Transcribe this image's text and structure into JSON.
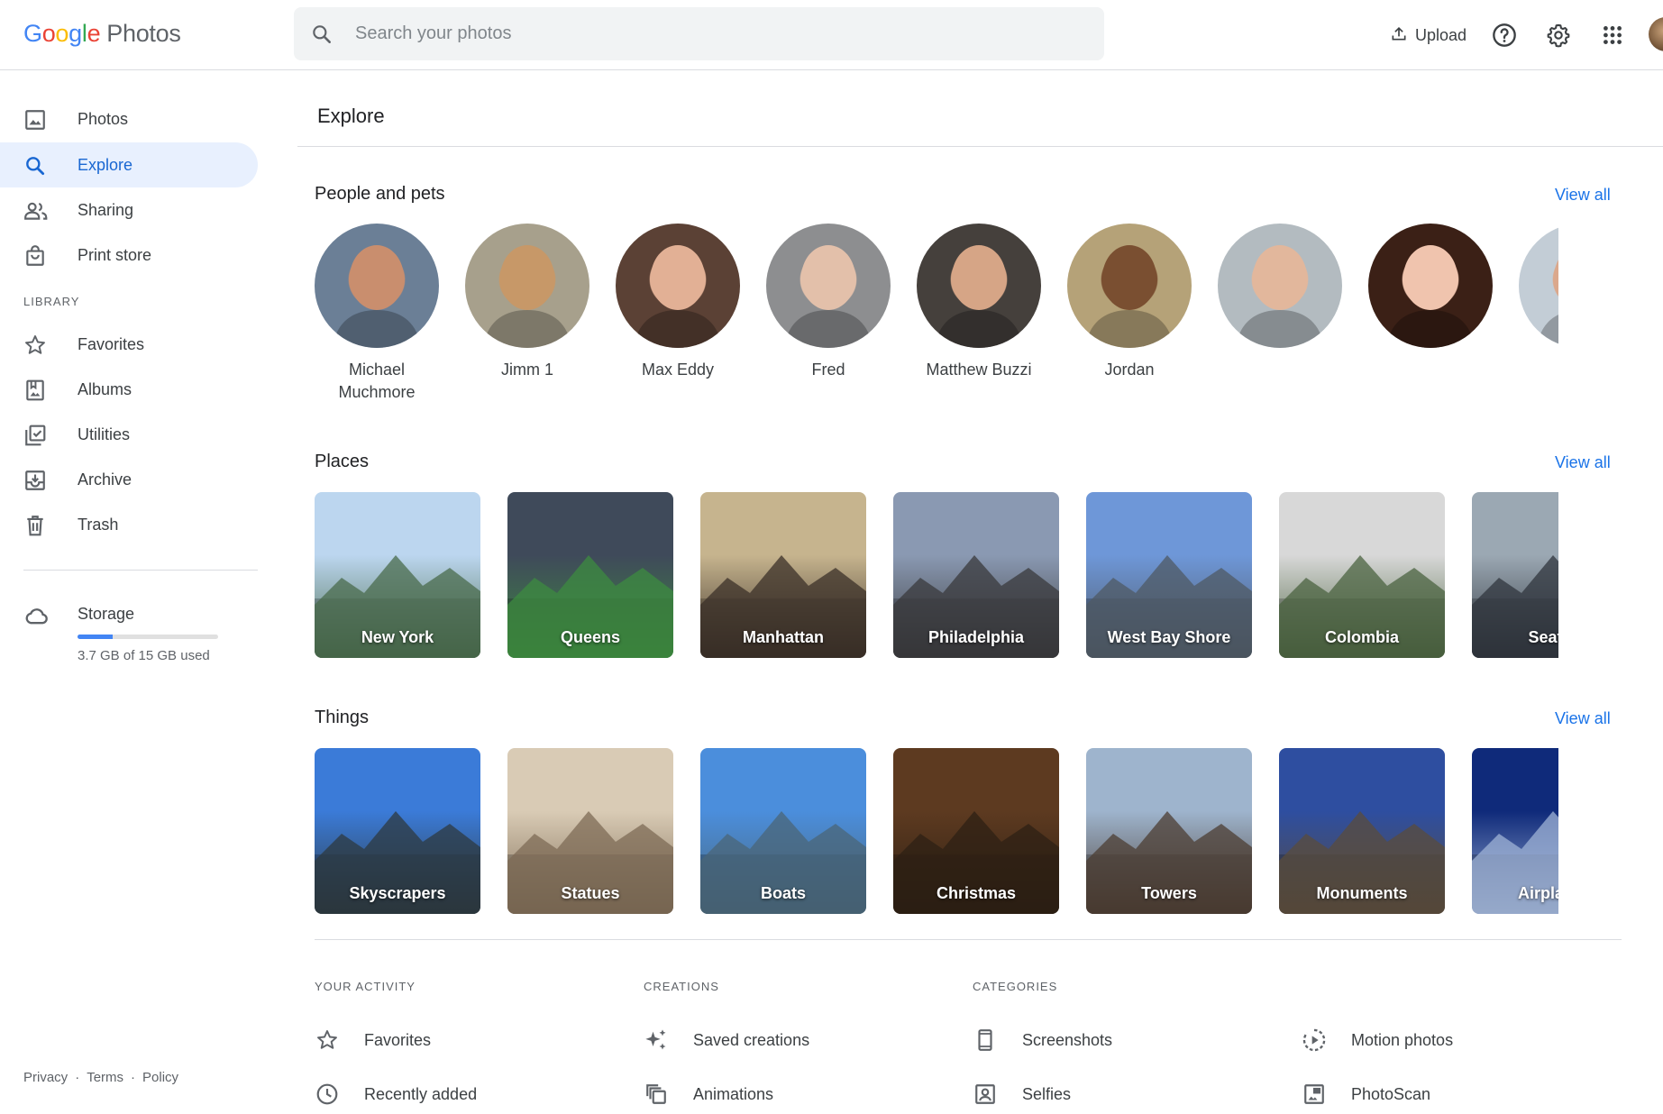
{
  "header": {
    "logo": {
      "letters": [
        "G",
        "o",
        "o",
        "g",
        "l",
        "e"
      ],
      "product": "Photos"
    },
    "search_placeholder": "Search your photos",
    "upload_label": "Upload",
    "icons": [
      "search-icon",
      "upload-icon",
      "help-icon",
      "settings-icon",
      "apps-grid-icon"
    ]
  },
  "sidebar": {
    "items": [
      {
        "label": "Photos",
        "icon": "photo-icon",
        "active": false
      },
      {
        "label": "Explore",
        "icon": "search-icon",
        "active": true
      },
      {
        "label": "Sharing",
        "icon": "people-icon",
        "active": false
      },
      {
        "label": "Print store",
        "icon": "shopping-bag-icon",
        "active": false
      }
    ],
    "library_heading": "LIBRARY",
    "library_items": [
      {
        "label": "Favorites",
        "icon": "star-icon"
      },
      {
        "label": "Albums",
        "icon": "album-icon"
      },
      {
        "label": "Utilities",
        "icon": "utilities-icon"
      },
      {
        "label": "Archive",
        "icon": "archive-icon"
      },
      {
        "label": "Trash",
        "icon": "trash-icon"
      }
    ],
    "storage": {
      "label": "Storage",
      "usage_text": "3.7 GB of 15 GB used",
      "used_fraction": 0.247
    },
    "footer": {
      "privacy": "Privacy",
      "terms": "Terms",
      "policy": "Policy",
      "sep": "·"
    }
  },
  "main": {
    "title": "Explore",
    "view_all": "View all",
    "people": {
      "title": "People and pets",
      "items": [
        {
          "name": "Michael Muchmore",
          "skin": "#c98e6e",
          "bg": "#6b7f96"
        },
        {
          "name": "Jimm   1",
          "skin": "#c79868",
          "bg": "#a7a08c"
        },
        {
          "name": "Max Eddy",
          "skin": "#e2b095",
          "bg": "#5b4135"
        },
        {
          "name": "Fred",
          "skin": "#e3c0aa",
          "bg": "#8d8e90"
        },
        {
          "name": "Matthew Buzzi",
          "skin": "#d6a586",
          "bg": "#45403c"
        },
        {
          "name": "Jordan",
          "skin": "#7a4f31",
          "bg": "#b5a278"
        },
        {
          "name": "",
          "skin": "#e2b79c",
          "bg": "#b3bbc0"
        },
        {
          "name": "",
          "skin": "#f0c4ae",
          "bg": "#3b2016"
        },
        {
          "name": "",
          "skin": "#dba88c",
          "bg": "#c3cdd6"
        }
      ]
    },
    "places": {
      "title": "Places",
      "items": [
        {
          "label": "New York",
          "top": "#bcd6ef",
          "bottom": "#496b4c"
        },
        {
          "label": "Queens",
          "top": "#3f4a5a",
          "bottom": "#3e8b40"
        },
        {
          "label": "Manhattan",
          "top": "#c6b48e",
          "bottom": "#3b3028"
        },
        {
          "label": "Philadelphia",
          "top": "#8a99b2",
          "bottom": "#3a3a3c"
        },
        {
          "label": "West Bay Shore",
          "top": "#6e97d8",
          "bottom": "#4f5964"
        },
        {
          "label": "Colombia",
          "top": "#d8d8d8",
          "bottom": "#4b6340"
        },
        {
          "label": "Seattle",
          "top": "#9ba8b3",
          "bottom": "#30363d"
        }
      ]
    },
    "things": {
      "title": "Things",
      "items": [
        {
          "label": "Skyscrapers",
          "top": "#3b7bd8",
          "bottom": "#2e3a40"
        },
        {
          "label": "Statues",
          "top": "#d9cbb5",
          "bottom": "#7d6b55"
        },
        {
          "label": "Boats",
          "top": "#4b8edc",
          "bottom": "#4a6678"
        },
        {
          "label": "Christmas",
          "top": "#5d3a20",
          "bottom": "#2e2014"
        },
        {
          "label": "Towers",
          "top": "#9eb4cd",
          "bottom": "#4c3d33"
        },
        {
          "label": "Monuments",
          "top": "#2e4ea0",
          "bottom": "#5a4c3c"
        },
        {
          "label": "Airplanes",
          "top": "#0f2a7a",
          "bottom": "#9fb3d6"
        }
      ]
    },
    "activity": {
      "heading": "YOUR ACTIVITY",
      "items": [
        {
          "label": "Favorites",
          "icon": "star-icon"
        },
        {
          "label": "Recently added",
          "icon": "clock-icon"
        }
      ]
    },
    "creations": {
      "heading": "CREATIONS",
      "items": [
        {
          "label": "Saved creations",
          "icon": "sparkle-icon"
        },
        {
          "label": "Animations",
          "icon": "animation-icon"
        }
      ]
    },
    "categories": {
      "heading": "CATEGORIES",
      "items": [
        {
          "label": "Screenshots",
          "icon": "phone-icon"
        },
        {
          "label": "Selfies",
          "icon": "selfie-icon"
        },
        {
          "label": "Motion photos",
          "icon": "motion-icon"
        },
        {
          "label": "PhotoScan",
          "icon": "photoscan-icon"
        }
      ]
    },
    "colors": {
      "accent": "#1a73e8",
      "active_bg": "#e8f0fe",
      "active_text": "#1967d2"
    }
  }
}
